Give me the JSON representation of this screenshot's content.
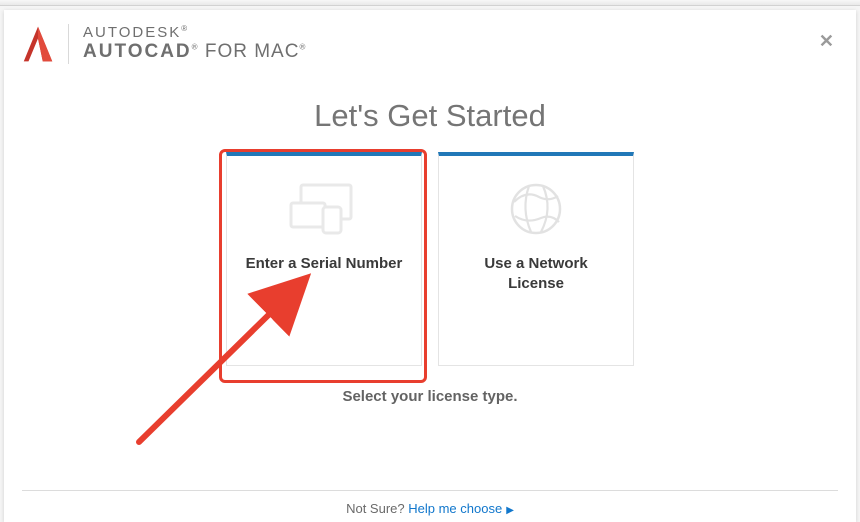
{
  "brand": {
    "line1": "AUTODESK",
    "line2_bold": "AUTOCAD",
    "line2_rest": " FOR MAC"
  },
  "title": "Let's Get Started",
  "cards": [
    {
      "label": "Enter a Serial Number"
    },
    {
      "label": "Use a Network License"
    }
  ],
  "subtitle": "Select your license type.",
  "footer": {
    "prompt": "Not Sure?",
    "link": "Help me choose"
  },
  "colors": {
    "accent": "#2178b8",
    "link": "#1177cc",
    "highlight": "#e83e2e"
  }
}
